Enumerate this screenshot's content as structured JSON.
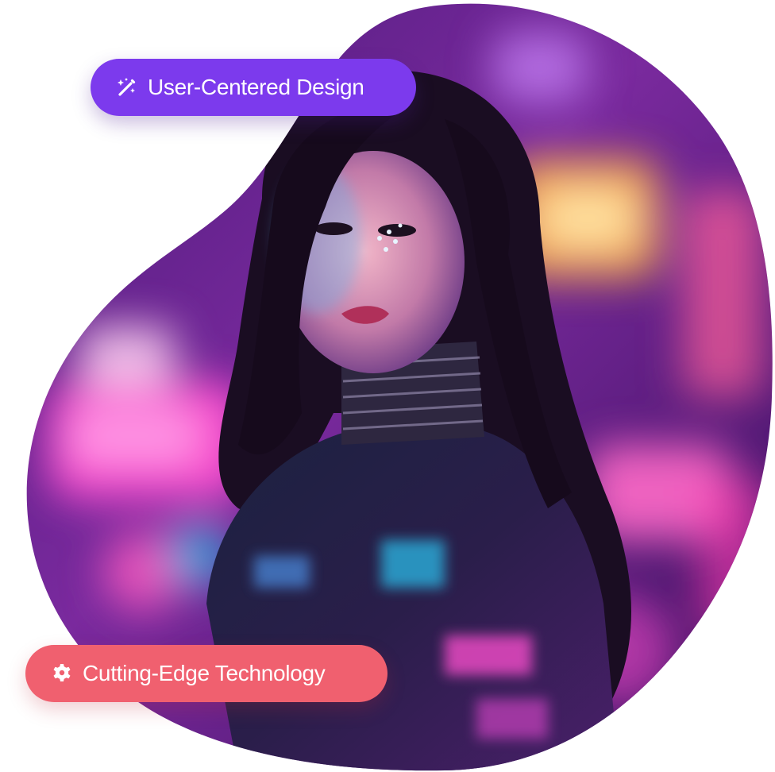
{
  "badges": {
    "design": {
      "label": "User-Centered Design",
      "icon": "magic-wand-icon",
      "color": "#7c3aed"
    },
    "tech": {
      "label": "Cutting-Edge Technology",
      "icon": "gear-icon",
      "color": "#f0606f"
    }
  },
  "photo": {
    "subject": "portrait-photo",
    "palette": [
      "#3a0f5c",
      "#c03fb8",
      "#ff4fd0",
      "#2bb9e6",
      "#ffb23a"
    ]
  }
}
